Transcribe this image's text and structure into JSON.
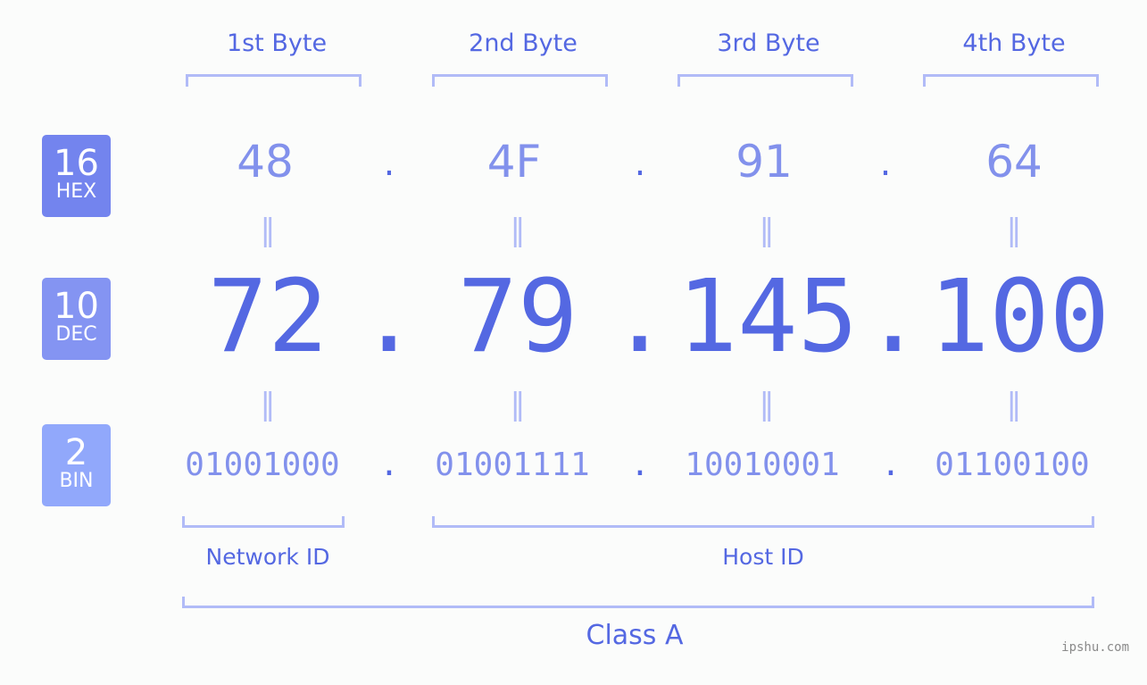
{
  "byte_headers": [
    "1st Byte",
    "2nd Byte",
    "3rd Byte",
    "4th Byte"
  ],
  "badges": [
    {
      "number": "16",
      "label": "HEX",
      "color": "#7384ee"
    },
    {
      "number": "10",
      "label": "DEC",
      "color": "#8494f2"
    },
    {
      "number": "2",
      "label": "BIN",
      "color": "#91a8fb"
    }
  ],
  "hex": [
    "48",
    "4F",
    "91",
    "64"
  ],
  "dec": [
    "72",
    "79",
    "145",
    "100"
  ],
  "bin": [
    "01001000",
    "01001111",
    "10010001",
    "01100100"
  ],
  "separator": ".",
  "equals": "=",
  "network_id_label": "Network ID",
  "host_id_label": "Host ID",
  "class_label": "Class A",
  "watermark": "ipshu.com",
  "colors": {
    "accent": "#5468e2",
    "light_accent": "#8291ec",
    "bracket": "#b1bbf7",
    "background": "#fbfcfb"
  }
}
